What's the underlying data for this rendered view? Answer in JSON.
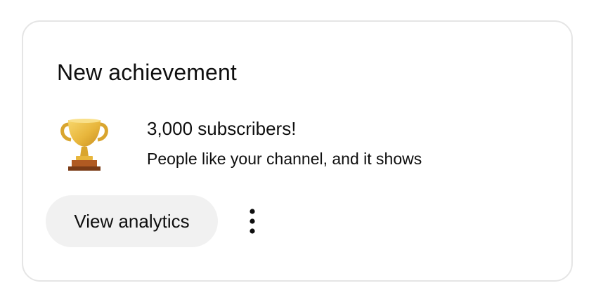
{
  "card": {
    "title": "New achievement",
    "achievement": {
      "icon": "trophy-icon",
      "heading": "3,000 subscribers!",
      "description": "People like your channel, and it shows"
    },
    "actions": {
      "view_analytics_label": "View analytics",
      "more_icon": "more-vertical-icon"
    }
  },
  "colors": {
    "card_border": "#e5e5e5",
    "button_background": "#f1f1f1",
    "text": "#0f0f0f",
    "trophy_gold": "#e8b63c",
    "trophy_base": "#7a3b16"
  }
}
